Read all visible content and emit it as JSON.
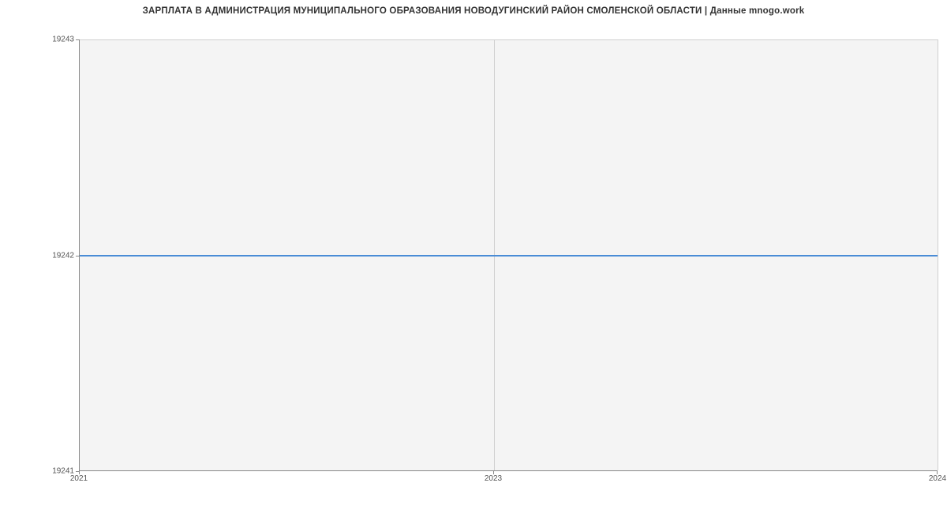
{
  "chart_data": {
    "type": "line",
    "title": "ЗАРПЛАТА В АДМИНИСТРАЦИЯ МУНИЦИПАЛЬНОГО ОБРАЗОВАНИЯ НОВОДУГИНСКИЙ РАЙОН СМОЛЕНСКОЙ ОБЛАСТИ | Данные mnogo.work",
    "x": [
      2021,
      2024
    ],
    "values": [
      19242,
      19242
    ],
    "xlabel": "",
    "ylabel": "",
    "x_ticks": [
      "2021",
      "2023",
      "2024"
    ],
    "y_ticks": [
      "19241",
      "19242",
      "19243"
    ],
    "xlim": [
      2021,
      2024
    ],
    "ylim": [
      19241,
      19243
    ],
    "grid": true
  }
}
